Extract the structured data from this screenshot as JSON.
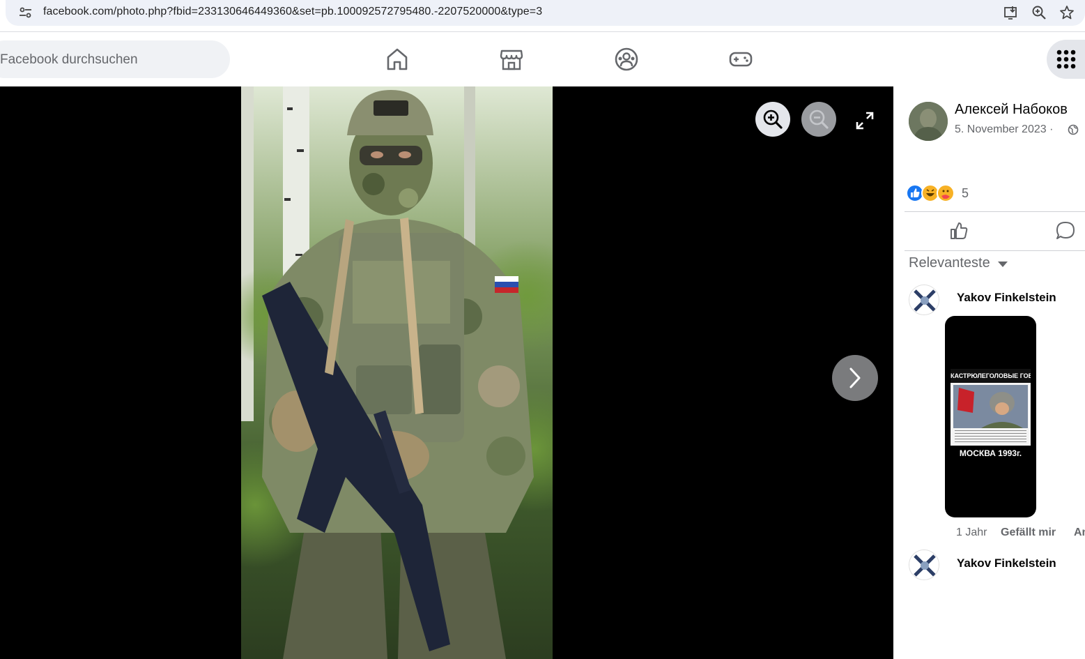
{
  "browser": {
    "url": "facebook.com/photo.php?fbid=233130646449360&set=pb.100092572795480.-2207520000&type=3"
  },
  "nav": {
    "search_placeholder": "Facebook durchsuchen"
  },
  "viewer": {
    "photo_alt": "Photo"
  },
  "post": {
    "author": "Алексей Набоков",
    "date": "5. November 2023 ·",
    "reaction_count": "5"
  },
  "comments": {
    "sort_label": "Relevanteste",
    "items": [
      {
        "author": "Yakov Finkelstein",
        "image_caption_top": "КАСТРЮЛЕГОЛОВЫЕ ГОВОРИШЬ?",
        "image_caption_bottom": "МОСКВА 1993г.",
        "age": "1 Jahr",
        "like_label": "Gefällt mir",
        "reply_label": "An"
      },
      {
        "author": "Yakov Finkelstein"
      }
    ]
  },
  "colors": {
    "accent": "#1877f2",
    "text_secondary": "#65676b",
    "viewer_bg": "#000000"
  }
}
